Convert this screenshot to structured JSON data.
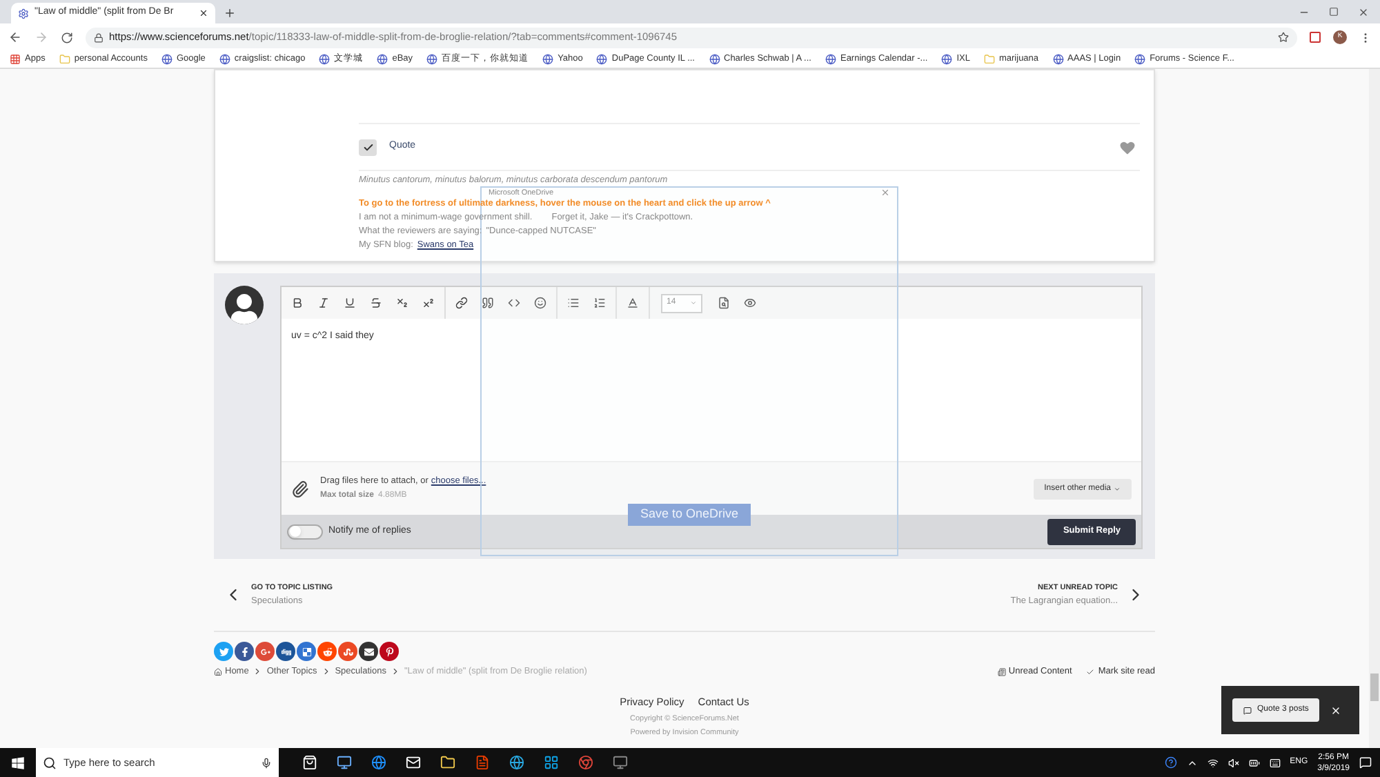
{
  "browser": {
    "tab_title": "\"Law of middle\" (split from De Br",
    "url_host": "https://www.scienceforums.net",
    "url_path": "/topic/118333-law-of-middle-split-from-de-broglie-relation/?tab=comments#comment-1096745",
    "profile_initial": "K"
  },
  "bookmarks": [
    {
      "kind": "apps",
      "label": "Apps"
    },
    {
      "kind": "folder",
      "label": "personal Accounts"
    },
    {
      "kind": "site",
      "label": "Google"
    },
    {
      "kind": "site",
      "label": "craigslist: chicago"
    },
    {
      "kind": "site",
      "label": "文学城"
    },
    {
      "kind": "site",
      "label": "eBay"
    },
    {
      "kind": "site",
      "label": "百度一下，你就知道"
    },
    {
      "kind": "site",
      "label": "Yahoo"
    },
    {
      "kind": "site",
      "label": "DuPage County IL ..."
    },
    {
      "kind": "site",
      "label": "Charles Schwab | A ..."
    },
    {
      "kind": "site",
      "label": "Earnings Calendar -..."
    },
    {
      "kind": "site",
      "label": "IXL"
    },
    {
      "kind": "folder",
      "label": "marijuana"
    },
    {
      "kind": "site",
      "label": "AAAS | Login"
    },
    {
      "kind": "site",
      "label": "Forums - Science F..."
    }
  ],
  "post": {
    "quote_checked": true,
    "quote_label": "Quote",
    "signature": {
      "motto": "Minutus cantorum, minutus balorum, minutus carborata descendum pantorum",
      "warning": "To go to the fortress of ultimate darkness, hover the mouse on the heart and click the up arrow ^",
      "shill": "I am not a minimum-wage government shill.",
      "jake": "Forget it, Jake — it's Crackpottown.",
      "reviews_label": "What the reviewers are saying:",
      "reviews_quote": "\"Dunce-capped NUTCASE\"",
      "blog_label": "My SFN blog:",
      "blog_link": "Swans on Tea"
    }
  },
  "editor": {
    "font_size": "14",
    "value": "uv = c^2 I said they",
    "attach_text": "Drag files here to attach, or",
    "attach_link": "choose files...",
    "max_size_label": "Max total size",
    "max_size_value": "4.88MB",
    "insert_media": "Insert other media",
    "notify_on": false,
    "notify_label": "Notify me of replies",
    "submit": "Submit Reply"
  },
  "topic_nav": {
    "prev_heading": "GO TO TOPIC LISTING",
    "prev_title": "Speculations",
    "next_heading": "NEXT UNREAD TOPIC",
    "next_title": "The Lagrangian equation..."
  },
  "breadcrumb": [
    "Home",
    "Other Topics",
    "Speculations",
    "\"Law of middle\" (split from De Broglie relation)"
  ],
  "footer_actions": [
    "Unread Content",
    "Mark site read"
  ],
  "footer": {
    "privacy": "Privacy Policy",
    "contact": "Contact Us",
    "copyright": "Copyright © ScienceForums.Net",
    "powered": "Powered by Invision Community"
  },
  "quote_popup": {
    "label": "Quote 3 posts"
  },
  "onedrive": {
    "title": "Microsoft OneDrive",
    "save_button": "Save to OneDrive"
  },
  "taskbar": {
    "search_placeholder": "Type here to search",
    "language": "ENG",
    "time": "2:56 PM",
    "date": "3/9/2019"
  }
}
